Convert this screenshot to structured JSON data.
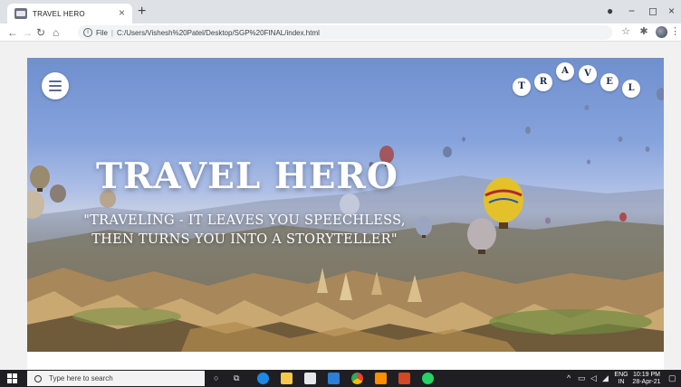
{
  "browser": {
    "tab_title": "TRAVEL HERO",
    "tab_close": "×",
    "new_tab": "+",
    "address_prefix": "File",
    "address_url": "C:/Users/Vishesh%20Patel/Desktop/SGP%20FINAL/index.html",
    "window_minimize": "−",
    "window_maximize": "◻",
    "window_close": "×"
  },
  "hero": {
    "title": "TRAVEL HERO",
    "quote_line1": "\"TRAVELING - IT LEAVES YOU SPEECHLESS,",
    "quote_line2": "THEN TURNS YOU INTO A STORYTELLER\"",
    "travel_letters": [
      "T",
      "R",
      "A",
      "V",
      "E",
      "L"
    ]
  },
  "taskbar": {
    "search_placeholder": "Type here to search",
    "lang_top": "ENG",
    "lang_bottom": "IN",
    "time": "10:19 PM",
    "date": "28-Apr-21"
  },
  "colors": {
    "sky_top": "#6f8fce",
    "balloon_yellow": "#e3c12b",
    "taskbar": "#1f1f23"
  }
}
